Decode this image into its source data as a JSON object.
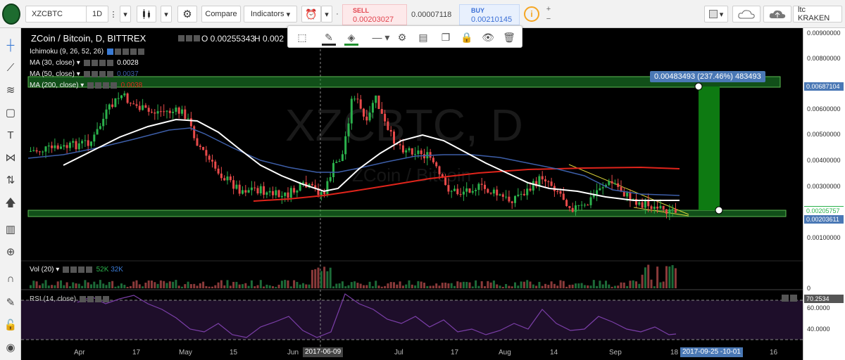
{
  "toolbar": {
    "symbol": "XZCBTC",
    "interval": "1D",
    "compare_label": "Compare",
    "indicators_label": "Indicators",
    "sell_label": "SELL",
    "sell_price": "0.00203027",
    "spread": "0.00007118",
    "buy_label": "BUY",
    "buy_price": "0.00210145",
    "info_glyph": "i",
    "broker": "ltc KRAKEN"
  },
  "legend": {
    "title": "ZCoin / Bitcoin, D, BITTREX",
    "open": "O 0.00255343",
    "high": "H 0.002",
    "ichimoku": "Ichimoku (9, 26, 52, 26)",
    "ma30_label": "MA (30, close)",
    "ma30_value": "0.0028",
    "ma50_label": "MA (50, close)",
    "ma50_value": "0.0037",
    "ma200_label": "MA (200, close)",
    "ma200_value": "0.0038",
    "vol_label": "Vol (20)",
    "vol_v1": "52K",
    "vol_v2": "32K",
    "rsi_label": "RSI (14, close)"
  },
  "watermark": {
    "main": "XZCBTC, D",
    "sub": "ZCoin / Bitcoin"
  },
  "measure": {
    "callout": "0.00483493 (237.46%) 483493"
  },
  "price_axis": {
    "ticks": [
      "0.00900000",
      "0.00800000",
      "0.00600000",
      "0.00500000",
      "0.00400000",
      "0.00300000",
      "0.00100000"
    ],
    "tag_upper": "0.00687104",
    "tag_mid": "0.00205757",
    "tag_lower": "0.00203611",
    "vol_zero": "0",
    "rsi_tag": "70.2534",
    "rsi_60": "60.0000",
    "rsi_40": "40.0000"
  },
  "time_axis": {
    "labels": [
      "Apr",
      "17",
      "May",
      "15",
      "Jun",
      "Jul",
      "17",
      "Aug",
      "14",
      "Sep",
      "18",
      "16"
    ],
    "cursor_date": "2017-06-09",
    "range_label": "2017-09-25 -10-01"
  },
  "colors": {
    "candle_up": "#2bb24c",
    "candle_down": "#e84a4a",
    "ma30": "#ffffff",
    "ma50": "#3d5ea8",
    "ma200": "#e0241b",
    "rsi": "#7b3fa8",
    "box_fill": "#1f8f2e"
  },
  "icons": {
    "left_tools": [
      "crosshair-icon",
      "trend-line-icon",
      "fib-icon",
      "rectangle-icon",
      "text-icon",
      "pattern-icon",
      "prediction-icon",
      "arrow-up-icon",
      "measure-icon",
      "zoom-icon",
      "magnet-icon",
      "lock-draw-icon",
      "lock-icon",
      "eye-icon"
    ],
    "draw_tools": [
      "select-area-icon",
      "pencil-icon",
      "fill-icon",
      "line-style-icon",
      "settings-icon",
      "visual-order-icon",
      "clone-icon",
      "lock-icon",
      "eye-icon",
      "trash-icon"
    ]
  }
}
